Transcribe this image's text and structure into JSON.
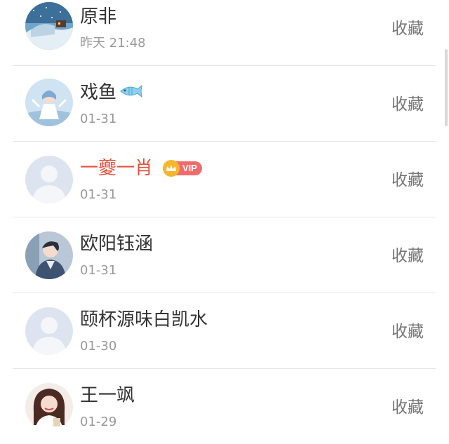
{
  "list": {
    "items": [
      {
        "name": "原非",
        "date": "昨天 21:48",
        "action": "收藏",
        "avatar": "snow-night-landscape-avatar"
      },
      {
        "name": "戏鱼",
        "date": "01-31",
        "action": "收藏",
        "avatar": "anime-girl-avatar",
        "name_icon": "fish-icon"
      },
      {
        "name": "一夔一肖",
        "date": "01-31",
        "action": "收藏",
        "avatar": "default-person-avatar",
        "vip_label": "VIP",
        "name_color": "#e8503d"
      },
      {
        "name": "欧阳钰涵",
        "date": "01-31",
        "action": "收藏",
        "avatar": "anime-boy-avatar"
      },
      {
        "name": "颐杯源味白凯水",
        "date": "01-30",
        "action": "收藏",
        "avatar": "default-person-avatar"
      },
      {
        "name": "王一飒",
        "date": "01-29",
        "action": "收藏",
        "avatar": "girl-photo-avatar"
      }
    ]
  },
  "colors": {
    "name": "#333333",
    "vip_name": "#e8503d",
    "date": "#999999",
    "action": "#777777",
    "divider": "#e6e6e6",
    "vip_badge": "#f06b6b",
    "vip_crown": "#f5b72e"
  }
}
